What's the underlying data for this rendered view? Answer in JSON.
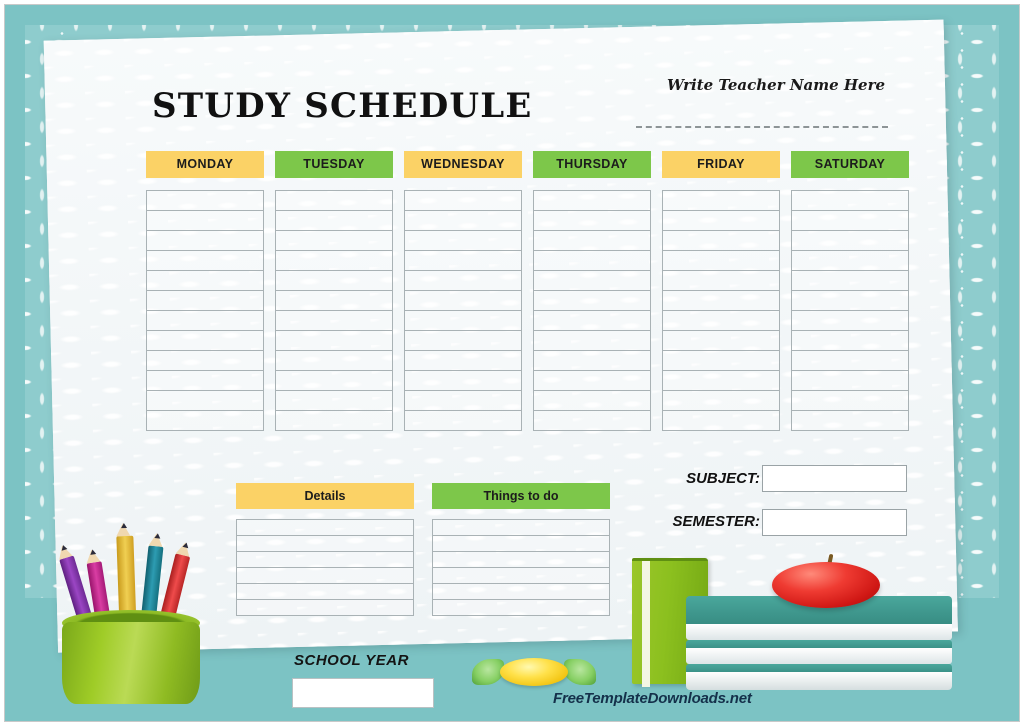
{
  "document": {
    "title": "STUDY SCHEDULE",
    "teacher_prompt": "Write Teacher Name Here"
  },
  "schedule": {
    "days": [
      {
        "label": "MONDAY",
        "color_name": "yellow",
        "color": "#fbd266",
        "rows": 12
      },
      {
        "label": "TUESDAY",
        "color_name": "green",
        "color": "#7dc74a",
        "rows": 12
      },
      {
        "label": "WEDNESDAY",
        "color_name": "yellow",
        "color": "#fbd266",
        "rows": 12
      },
      {
        "label": "THURSDAY",
        "color_name": "green",
        "color": "#7dc74a",
        "rows": 12
      },
      {
        "label": "FRIDAY",
        "color_name": "yellow",
        "color": "#fbd266",
        "rows": 12
      },
      {
        "label": "SATURDAY",
        "color_name": "green",
        "color": "#7dc74a",
        "rows": 12
      }
    ]
  },
  "notes": {
    "details_label": "Details",
    "details_color": "#fbd266",
    "details_rows": 6,
    "things_label": "Things to do",
    "things_color": "#7dc74a",
    "things_rows": 6
  },
  "fields": {
    "subject_label": "SUBJECT:",
    "subject_value": "",
    "semester_label": "SEMESTER:",
    "semester_value": "",
    "school_year_label": "SCHOOL YEAR",
    "school_year_value": ""
  },
  "footer": {
    "watermark": "FreeTemplateDownloads.net"
  },
  "theme": {
    "teal_border": "#7cc3c4",
    "teal_pattern": "#8ecccd",
    "paper": "#f2f6f7",
    "yellow": "#fbd266",
    "green": "#7dc74a",
    "grid_line": "#a9b2b5",
    "watermark_color": "#14304a"
  },
  "decorations": {
    "pencil_cup": {
      "name": "pencil-cup",
      "cup_color": "#9fcc27",
      "pencils": [
        {
          "name": "pencil-purple",
          "color": "#7b2f9e"
        },
        {
          "name": "pencil-magenta",
          "color": "#c4238c"
        },
        {
          "name": "pencil-yellow",
          "color": "#e8c23a"
        },
        {
          "name": "pencil-teal",
          "color": "#1b7f92"
        },
        {
          "name": "pencil-red",
          "color": "#e03a3a"
        }
      ]
    },
    "candy": {
      "name": "candy",
      "body_color": "#ffe14a",
      "wrapper_color": "#86cf63"
    },
    "books": {
      "name": "book-stack",
      "standing_book_color": "#8cc01f",
      "stacked_book_color": "#34877e",
      "stacked_count": 3
    },
    "apple": {
      "name": "apple",
      "color": "#ef3b32"
    }
  }
}
